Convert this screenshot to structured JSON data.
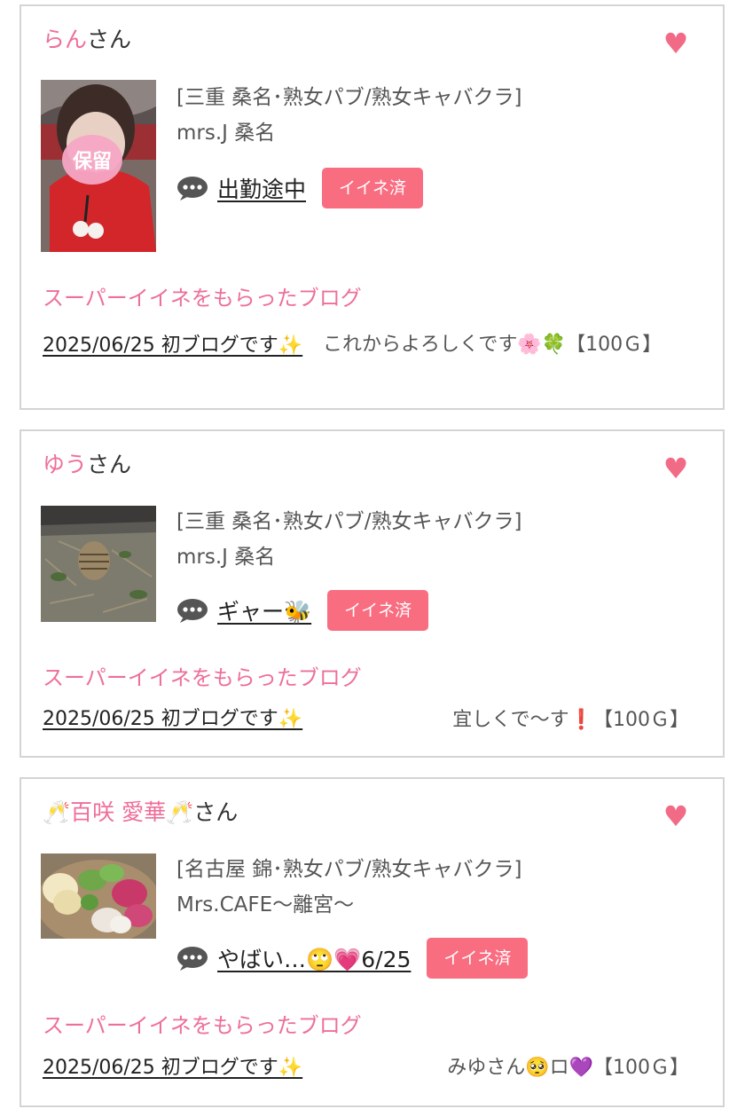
{
  "cards": [
    {
      "name_pink": "らん",
      "name_suffix": "さん",
      "shop_area": "[三重 桑名･熟女パブ/熟女キャバクラ]",
      "shop_name": "mrs.J 桑名",
      "blog_title": "出勤途中",
      "like_label": "イイネ済",
      "super_label": "スーパーイイネをもらったブログ",
      "post_title": "2025/06/25 初ブログです✨",
      "comment": "これからよろしくです🌸🍀【100Ｇ】",
      "thumb_stamp": "保留"
    },
    {
      "name_pink": "ゆう",
      "name_suffix": "さん",
      "shop_area": "[三重 桑名･熟女パブ/熟女キャバクラ]",
      "shop_name": "mrs.J 桑名",
      "blog_title": "ギャー🐝",
      "like_label": "イイネ済",
      "super_label": "スーパーイイネをもらったブログ",
      "post_title": "2025/06/25 初ブログです✨",
      "comment": "宜しくで〜す❗【100Ｇ】"
    },
    {
      "name_prefix": "🥂",
      "name_pink": "百咲 愛華",
      "name_mid": "🥂",
      "name_suffix": "さん",
      "shop_area": "[名古屋 錦･熟女パブ/熟女キャバクラ]",
      "shop_name": "Mrs.CAFE〜離宮〜",
      "blog_title": "やばい…🙄💗6/25",
      "like_label": "イイネ済",
      "super_label": "スーパーイイネをもらったブログ",
      "post_title": "2025/06/25 初ブログです✨",
      "comment": "みゆさん🥺ロ💜【100Ｇ】"
    }
  ],
  "icons": {
    "heart": "heart-icon",
    "bubble": "speech-bubble-icon"
  },
  "colors": {
    "accent_pink": "#ee6f9b",
    "button_pink": "#f96d81",
    "heart": "#f26b86",
    "border": "#d4d4d4"
  }
}
